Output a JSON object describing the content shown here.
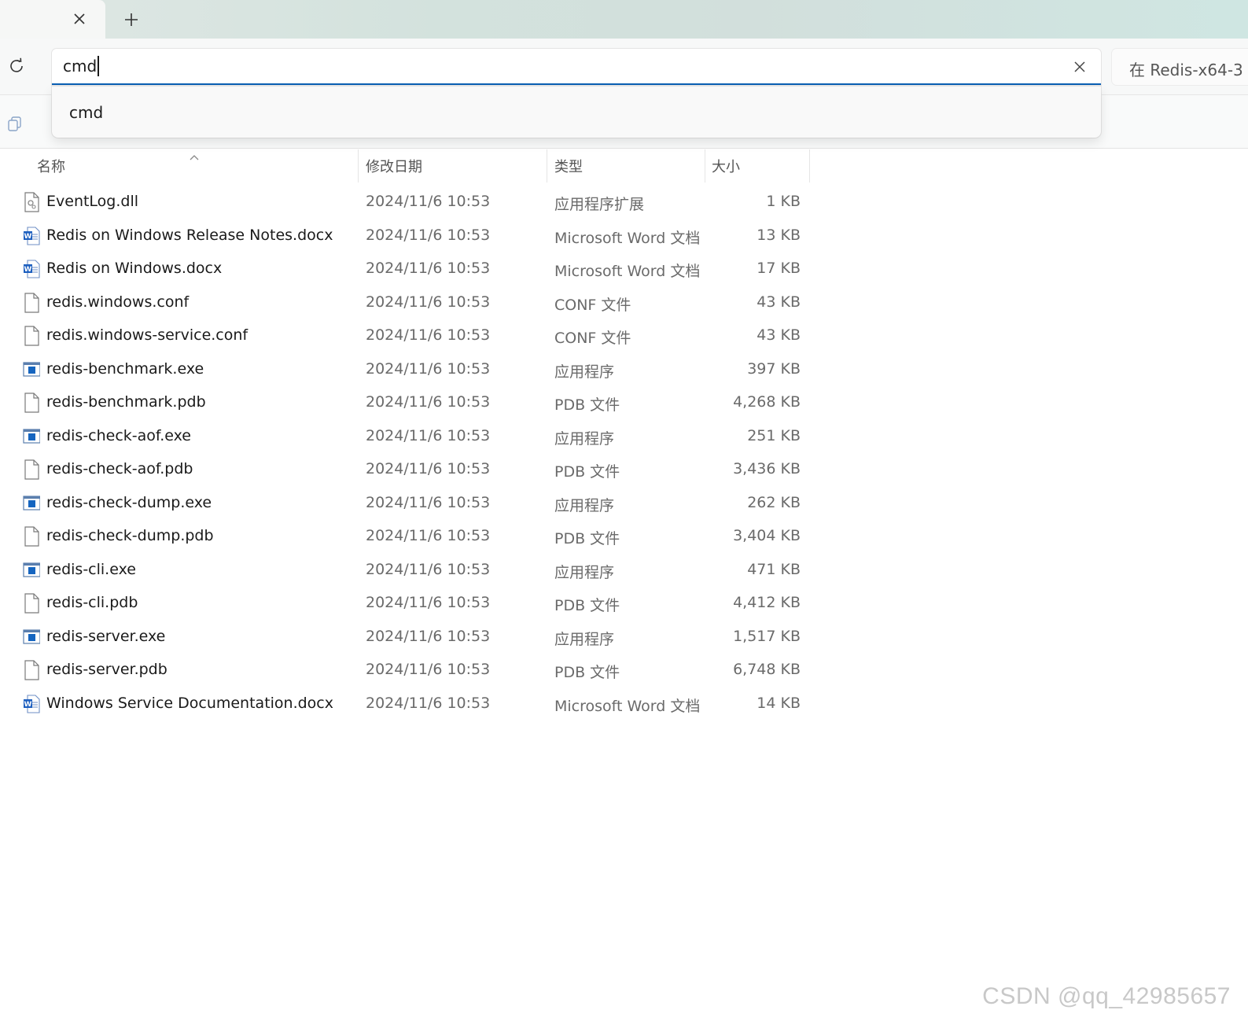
{
  "tabbar": {
    "new_tab_glyph": "+"
  },
  "address": {
    "value": "cmd",
    "suggestions": [
      "cmd"
    ]
  },
  "search": {
    "placeholder": "在 Redis-x64-3"
  },
  "columns": {
    "name": "名称",
    "date": "修改日期",
    "type": "类型",
    "size": "大小"
  },
  "files": [
    {
      "name": "EventLog.dll",
      "date": "2024/11/6 10:53",
      "type": "应用程序扩展",
      "size": "1 KB",
      "icon": "dll-file-icon"
    },
    {
      "name": "Redis on Windows Release Notes.docx",
      "date": "2024/11/6 10:53",
      "type": "Microsoft Word 文档",
      "size": "13 KB",
      "icon": "word-document-icon"
    },
    {
      "name": "Redis on Windows.docx",
      "date": "2024/11/6 10:53",
      "type": "Microsoft Word 文档",
      "size": "17 KB",
      "icon": "word-document-icon"
    },
    {
      "name": "redis.windows.conf",
      "date": "2024/11/6 10:53",
      "type": "CONF 文件",
      "size": "43 KB",
      "icon": "blank-file-icon"
    },
    {
      "name": "redis.windows-service.conf",
      "date": "2024/11/6 10:53",
      "type": "CONF 文件",
      "size": "43 KB",
      "icon": "blank-file-icon"
    },
    {
      "name": "redis-benchmark.exe",
      "date": "2024/11/6 10:53",
      "type": "应用程序",
      "size": "397 KB",
      "icon": "exe-app-icon"
    },
    {
      "name": "redis-benchmark.pdb",
      "date": "2024/11/6 10:53",
      "type": "PDB 文件",
      "size": "4,268 KB",
      "icon": "blank-file-icon"
    },
    {
      "name": "redis-check-aof.exe",
      "date": "2024/11/6 10:53",
      "type": "应用程序",
      "size": "251 KB",
      "icon": "exe-app-icon"
    },
    {
      "name": "redis-check-aof.pdb",
      "date": "2024/11/6 10:53",
      "type": "PDB 文件",
      "size": "3,436 KB",
      "icon": "blank-file-icon"
    },
    {
      "name": "redis-check-dump.exe",
      "date": "2024/11/6 10:53",
      "type": "应用程序",
      "size": "262 KB",
      "icon": "exe-app-icon"
    },
    {
      "name": "redis-check-dump.pdb",
      "date": "2024/11/6 10:53",
      "type": "PDB 文件",
      "size": "3,404 KB",
      "icon": "blank-file-icon"
    },
    {
      "name": "redis-cli.exe",
      "date": "2024/11/6 10:53",
      "type": "应用程序",
      "size": "471 KB",
      "icon": "exe-app-icon"
    },
    {
      "name": "redis-cli.pdb",
      "date": "2024/11/6 10:53",
      "type": "PDB 文件",
      "size": "4,412 KB",
      "icon": "blank-file-icon"
    },
    {
      "name": "redis-server.exe",
      "date": "2024/11/6 10:53",
      "type": "应用程序",
      "size": "1,517 KB",
      "icon": "exe-app-icon"
    },
    {
      "name": "redis-server.pdb",
      "date": "2024/11/6 10:53",
      "type": "PDB 文件",
      "size": "6,748 KB",
      "icon": "blank-file-icon"
    },
    {
      "name": "Windows Service Documentation.docx",
      "date": "2024/11/6 10:53",
      "type": "Microsoft Word 文档",
      "size": "14 KB",
      "icon": "word-document-icon"
    }
  ],
  "watermark": "CSDN @qq_42985657",
  "colors": {
    "accent": "#0a5fb4",
    "word_blue": "#1d5fbf",
    "exe_blue": "#1565c0"
  }
}
